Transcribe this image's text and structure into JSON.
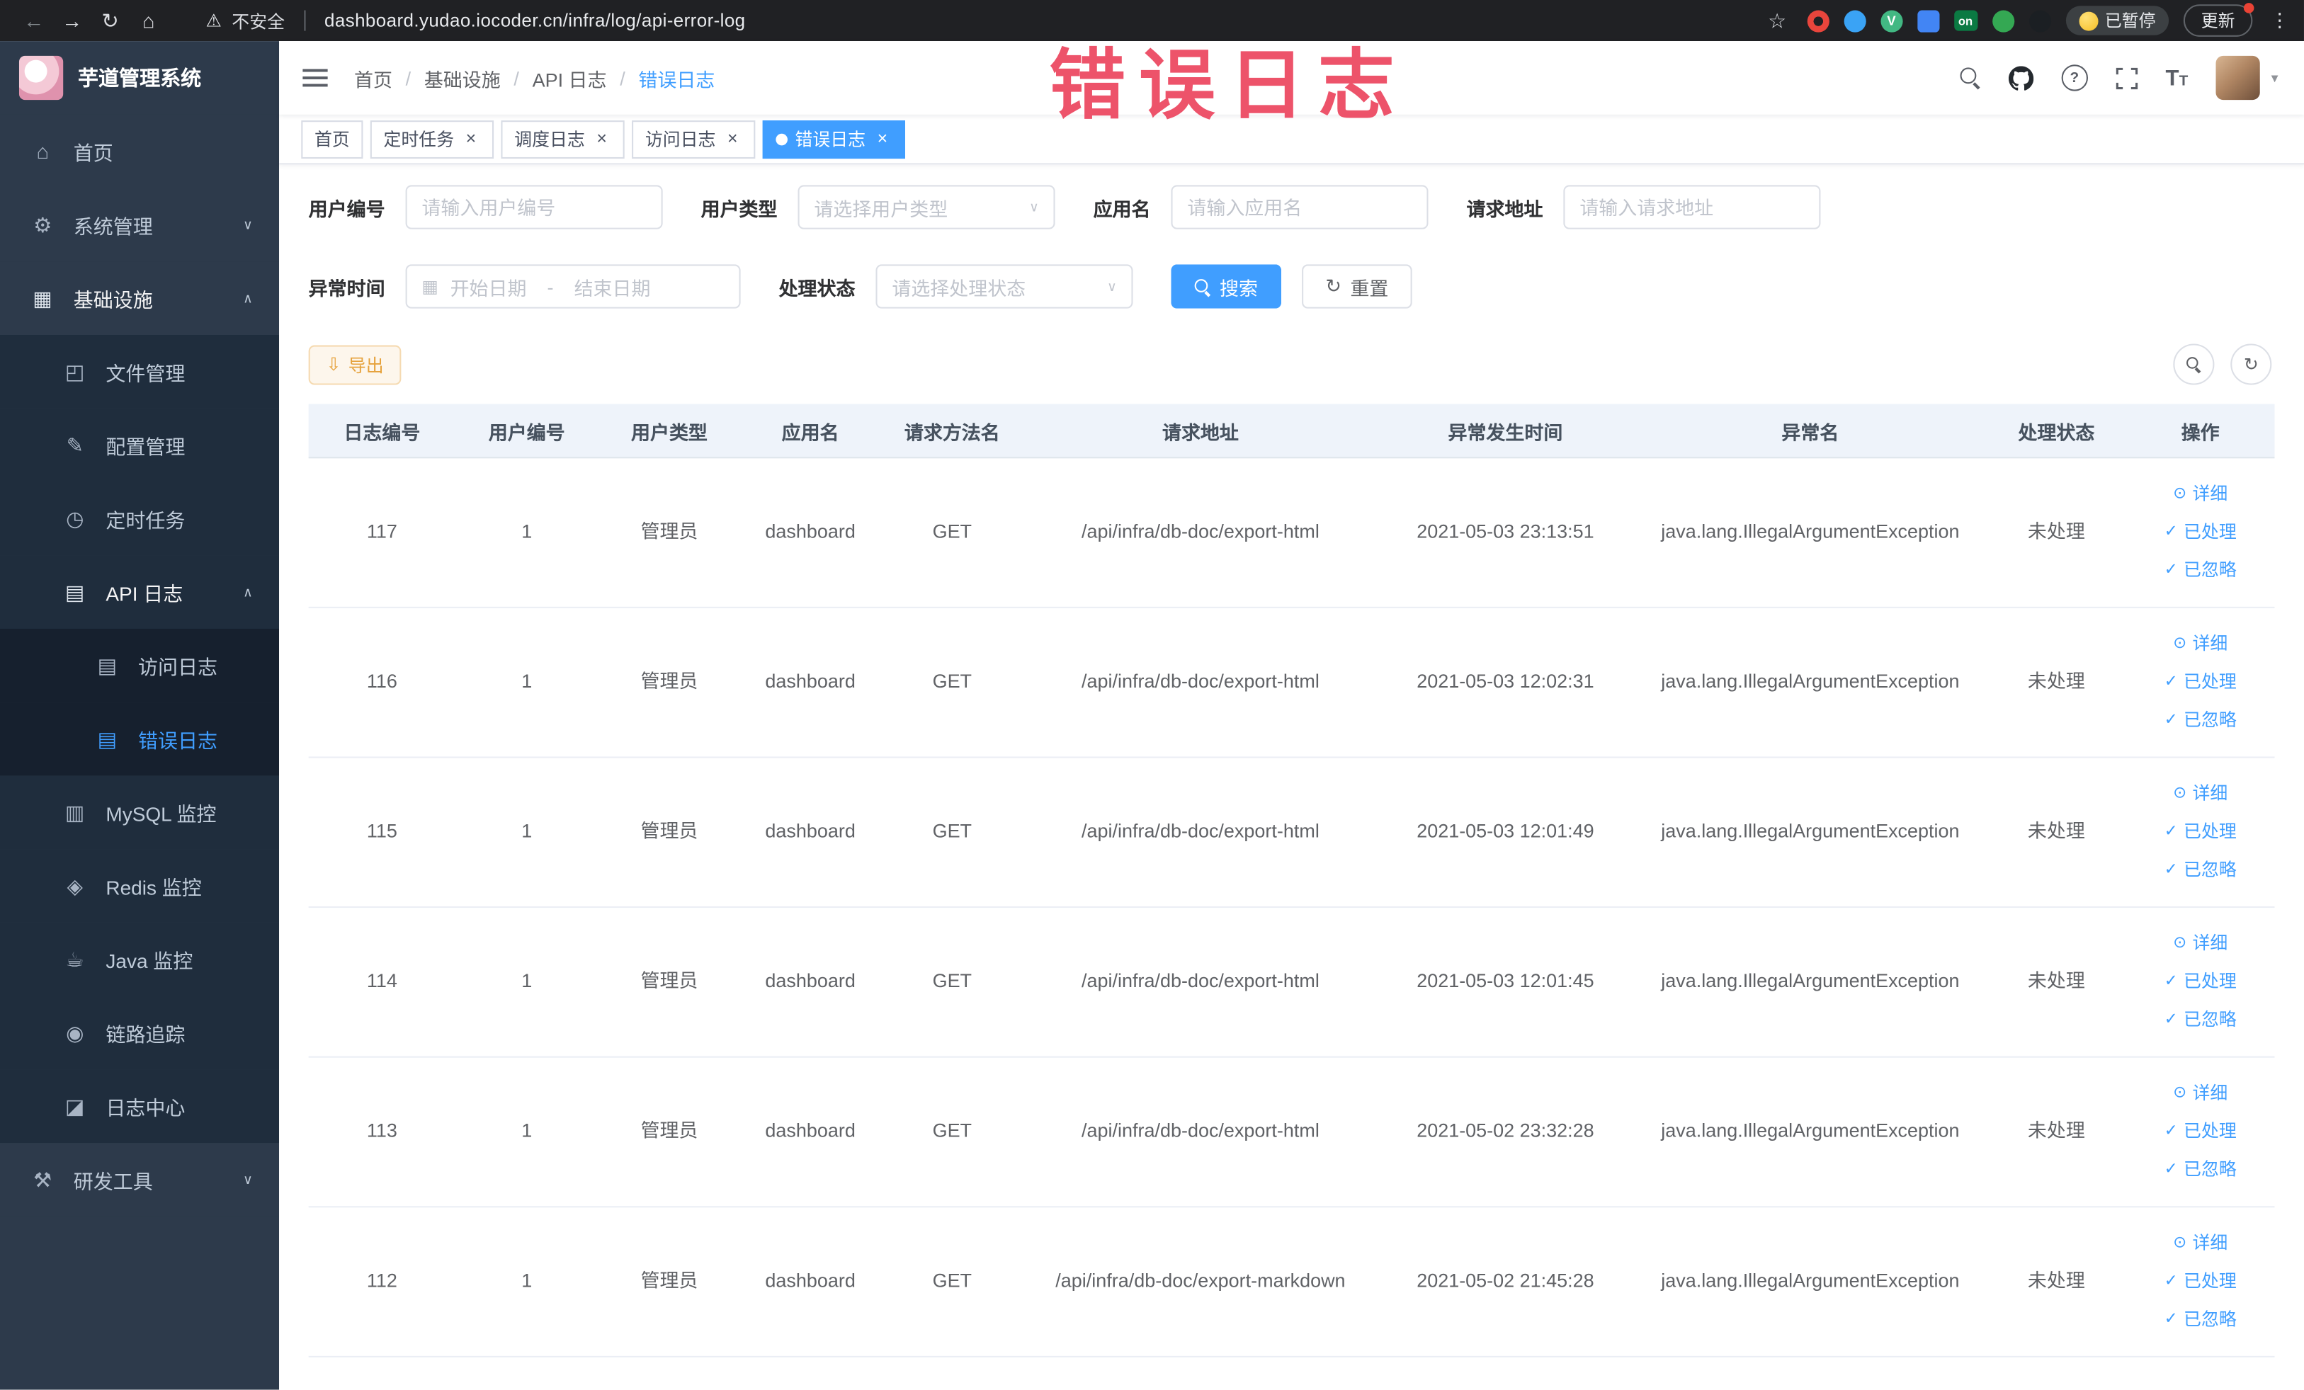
{
  "browser": {
    "security_label": "不安全",
    "url": "dashboard.yudao.iocoder.cn/infra/log/api-error-log",
    "ext_on_label": "on",
    "ext_vue_label": "V",
    "paused_badge": "已暂停",
    "update_button": "更新"
  },
  "annotation": {
    "text": "错误日志"
  },
  "sidebar": {
    "logo_title": "芋道管理系统",
    "menu": [
      {
        "name": "home",
        "label": "首页",
        "icon": "home",
        "level": 1
      },
      {
        "name": "system-management",
        "label": "系统管理",
        "icon": "gear",
        "level": 1,
        "arrow": "down"
      },
      {
        "name": "infrastructure",
        "label": "基础设施",
        "icon": "infra",
        "level": 1,
        "arrow": "up",
        "trail": true
      },
      {
        "name": "file-management",
        "label": "文件管理",
        "icon": "file",
        "level": 2
      },
      {
        "name": "config-management",
        "label": "配置管理",
        "icon": "config",
        "level": 2
      },
      {
        "name": "scheduled-jobs",
        "label": "定时任务",
        "icon": "timer",
        "level": 2
      },
      {
        "name": "api-log",
        "label": "API 日志",
        "icon": "doc",
        "level": 2,
        "arrow": "up",
        "trail": true
      },
      {
        "name": "access-log",
        "label": "访问日志",
        "icon": "doc",
        "level": 3
      },
      {
        "name": "error-log",
        "label": "错误日志",
        "icon": "doc",
        "level": 3,
        "active": true
      },
      {
        "name": "mysql-monitor",
        "label": "MySQL 监控",
        "icon": "db",
        "level": 2
      },
      {
        "name": "redis-monitor",
        "label": "Redis 监控",
        "icon": "redis",
        "level": 2
      },
      {
        "name": "java-monitor",
        "label": "Java 监控",
        "icon": "java",
        "level": 2
      },
      {
        "name": "trace",
        "label": "链路追踪",
        "icon": "trace",
        "level": 2
      },
      {
        "name": "log-center",
        "label": "日志中心",
        "icon": "logcenter",
        "level": 2
      },
      {
        "name": "dev-tools",
        "label": "研发工具",
        "icon": "tools",
        "level": 1,
        "arrow": "down"
      }
    ]
  },
  "header": {
    "breadcrumb": [
      "首页",
      "基础设施",
      "API 日志",
      "错误日志"
    ]
  },
  "tabs": [
    {
      "name": "home",
      "label": "首页",
      "closable": false,
      "active": false
    },
    {
      "name": "scheduled-jobs",
      "label": "定时任务",
      "closable": true,
      "active": false
    },
    {
      "name": "job-log",
      "label": "调度日志",
      "closable": true,
      "active": false
    },
    {
      "name": "access-log",
      "label": "访问日志",
      "closable": true,
      "active": false
    },
    {
      "name": "error-log",
      "label": "错误日志",
      "closable": true,
      "active": true
    }
  ],
  "filters": {
    "user_id": {
      "label": "用户编号",
      "placeholder": "请输入用户编号"
    },
    "user_type": {
      "label": "用户类型",
      "placeholder": "请选择用户类型"
    },
    "app_name": {
      "label": "应用名",
      "placeholder": "请输入应用名"
    },
    "request_url": {
      "label": "请求地址",
      "placeholder": "请输入请求地址"
    },
    "exception_time": {
      "label": "异常时间",
      "start_placeholder": "开始日期",
      "separator": "-",
      "end_placeholder": "结束日期"
    },
    "process_status": {
      "label": "处理状态",
      "placeholder": "请选择处理状态"
    },
    "search_label": "搜索",
    "reset_label": "重置"
  },
  "toolbar": {
    "export_label": "导出"
  },
  "table": {
    "columns": [
      "日志编号",
      "用户编号",
      "用户类型",
      "应用名",
      "请求方法名",
      "请求地址",
      "异常发生时间",
      "异常名",
      "处理状态",
      "操作"
    ],
    "actions": [
      "详细",
      "已处理",
      "已忽略"
    ],
    "rows": [
      {
        "id": "117",
        "user_id": "1",
        "user_type": "管理员",
        "app": "dashboard",
        "method": "GET",
        "url": "/api/infra/db-doc/export-html",
        "time": "2021-05-03 23:13:51",
        "exception": "java.lang.IllegalArgumentException",
        "status": "未处理"
      },
      {
        "id": "116",
        "user_id": "1",
        "user_type": "管理员",
        "app": "dashboard",
        "method": "GET",
        "url": "/api/infra/db-doc/export-html",
        "time": "2021-05-03 12:02:31",
        "exception": "java.lang.IllegalArgumentException",
        "status": "未处理"
      },
      {
        "id": "115",
        "user_id": "1",
        "user_type": "管理员",
        "app": "dashboard",
        "method": "GET",
        "url": "/api/infra/db-doc/export-html",
        "time": "2021-05-03 12:01:49",
        "exception": "java.lang.IllegalArgumentException",
        "status": "未处理"
      },
      {
        "id": "114",
        "user_id": "1",
        "user_type": "管理员",
        "app": "dashboard",
        "method": "GET",
        "url": "/api/infra/db-doc/export-html",
        "time": "2021-05-03 12:01:45",
        "exception": "java.lang.IllegalArgumentException",
        "status": "未处理"
      },
      {
        "id": "113",
        "user_id": "1",
        "user_type": "管理员",
        "app": "dashboard",
        "method": "GET",
        "url": "/api/infra/db-doc/export-html",
        "time": "2021-05-02 23:32:28",
        "exception": "java.lang.IllegalArgumentException",
        "status": "未处理"
      },
      {
        "id": "112",
        "user_id": "1",
        "user_type": "管理员",
        "app": "dashboard",
        "method": "GET",
        "url": "/api/infra/db-doc/export-markdown",
        "time": "2021-05-02 21:45:28",
        "exception": "java.lang.IllegalArgumentException",
        "status": "未处理"
      }
    ]
  },
  "colors": {
    "primary": "#409eff",
    "sidebar_bg": "#2d3a4b",
    "submenu_bg": "#1f2d3d",
    "warning_text": "#e6a23c",
    "annotation_red": "#ed4a63"
  }
}
